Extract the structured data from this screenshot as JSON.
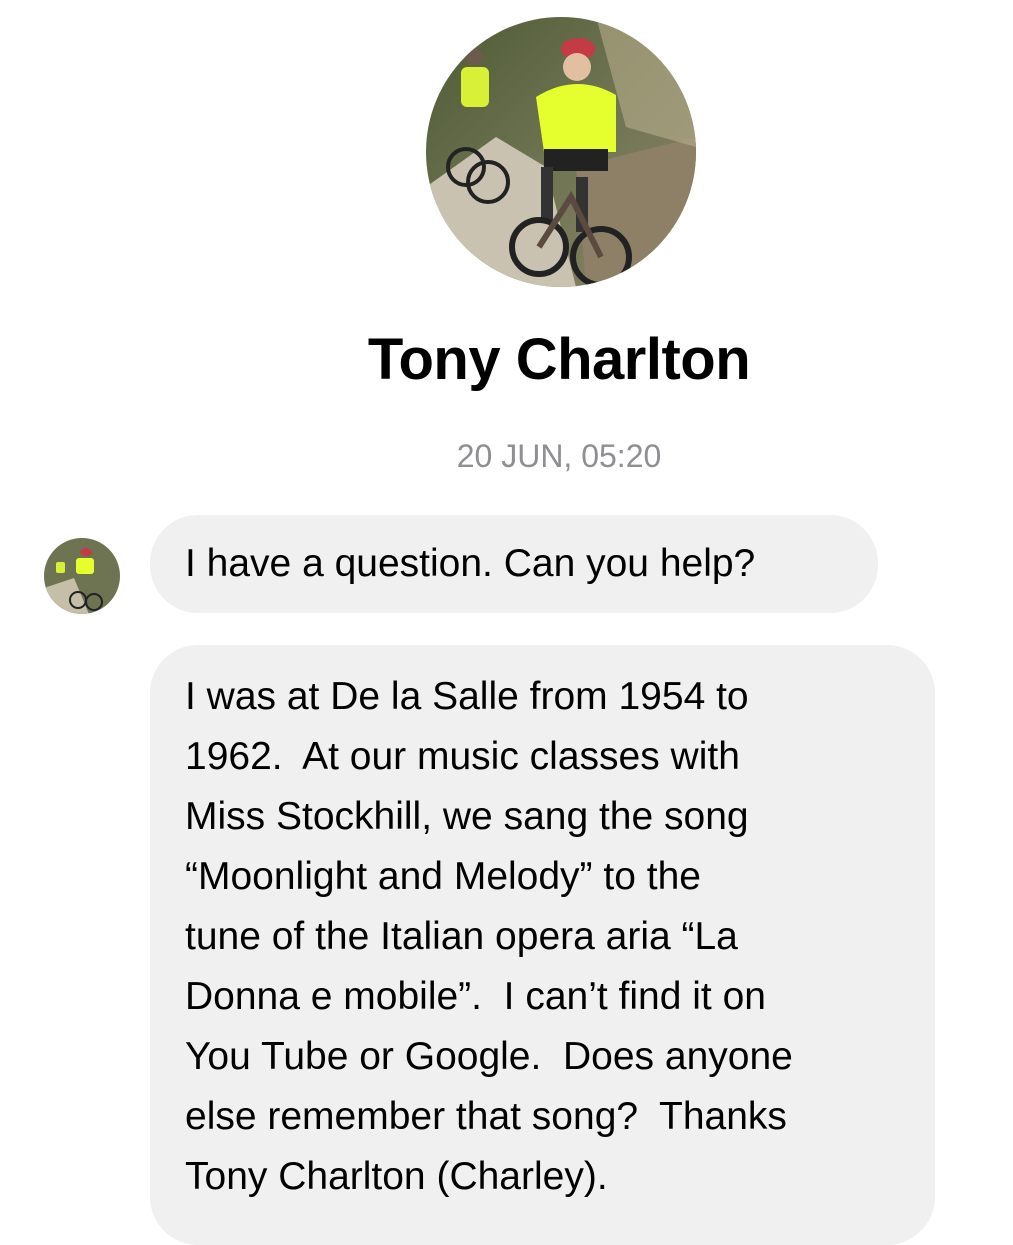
{
  "contact": {
    "name": "Tony Charlton",
    "photo_icon": "profile-photo-cyclists",
    "avatar_icon": "avatar-cyclists"
  },
  "conversation": {
    "timestamp": "20 JUN, 05:20",
    "messages": [
      {
        "text": "I have a question. Can you help?"
      },
      {
        "lines": [
          "I was at De la Salle from 1954 to",
          "1962.  At our music classes with",
          "Miss Stockhill, we sang the song",
          "“Moonlight and Melody” to the",
          "tune of the Italian opera aria “La",
          "Donna e mobile”.  I can’t find it on",
          "You Tube or Google.  Does anyone",
          "else remember that song?  Thanks",
          "Tony Charlton (Charley)."
        ]
      }
    ]
  },
  "colors": {
    "bubble_background": "#f0f0f0",
    "timestamp_text": "#8e8e93"
  }
}
